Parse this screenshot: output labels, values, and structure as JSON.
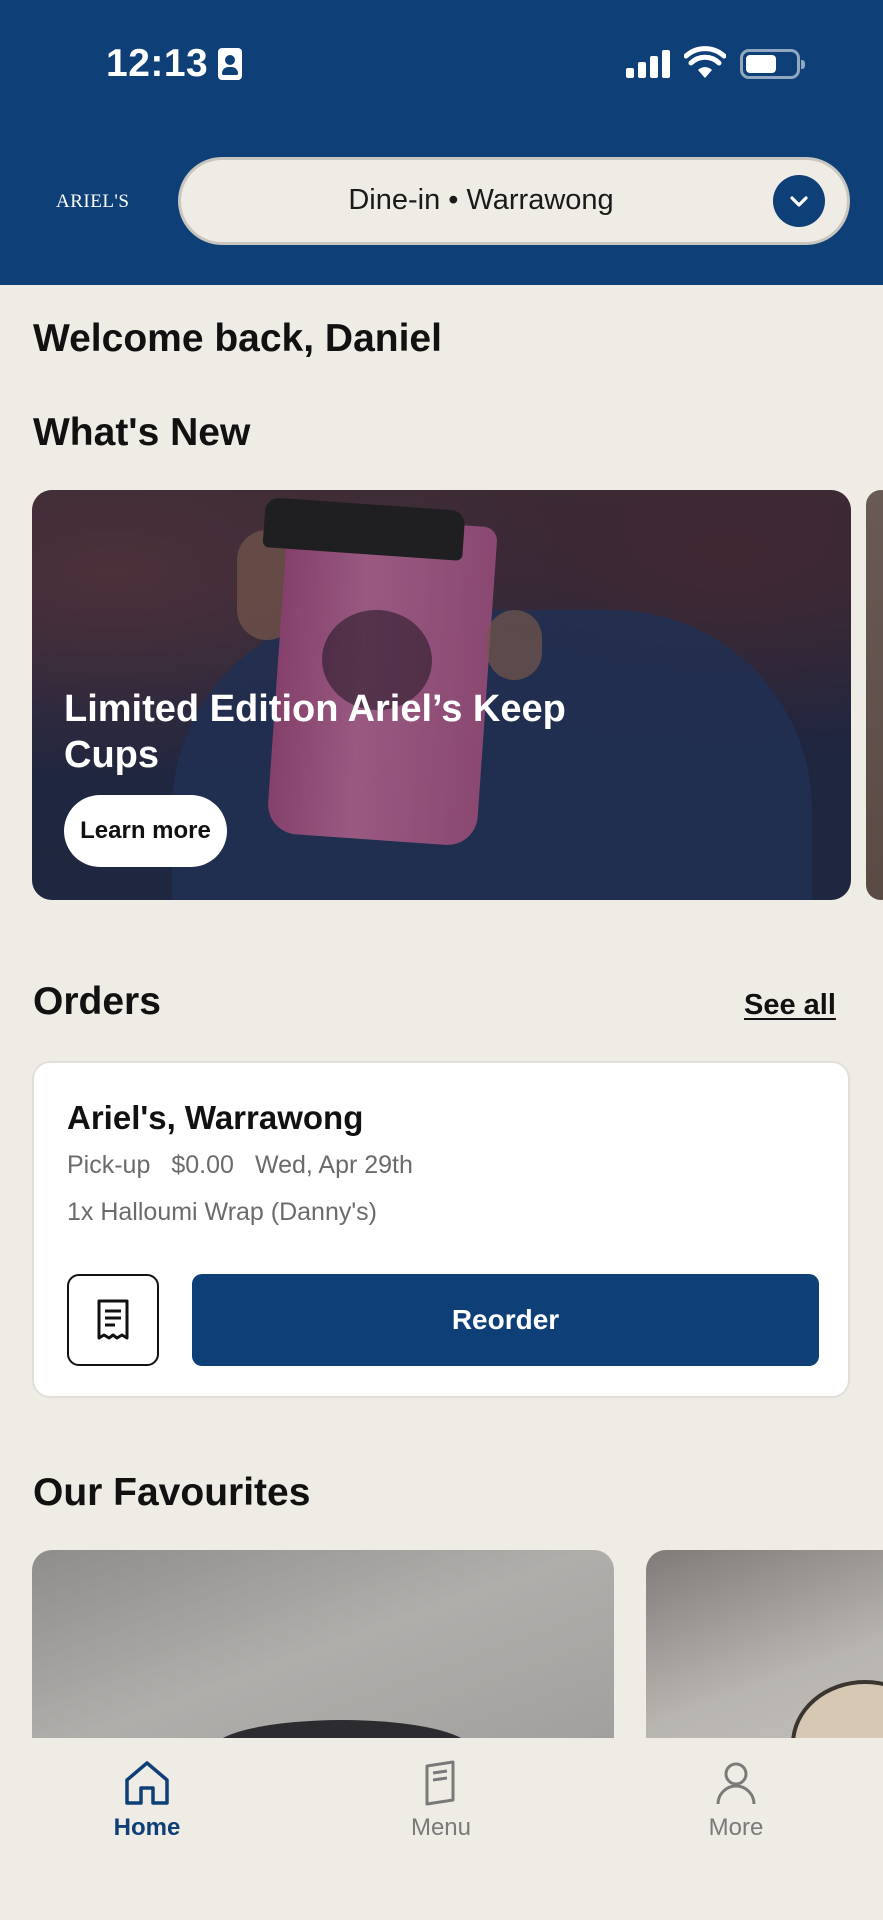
{
  "status_bar": {
    "time": "12:13"
  },
  "header": {
    "logo": "ARIEL'S",
    "location": "Dine-in • Warrawong"
  },
  "welcome": "Welcome back, Daniel",
  "whats_new": {
    "title": "What's New",
    "promo": {
      "title": "Limited Edition Ariel’s Keep Cups",
      "button": "Learn more"
    }
  },
  "orders": {
    "title": "Orders",
    "see_all": "See all",
    "card": {
      "store": "Ariel's, Warrawong",
      "type": "Pick-up",
      "price": "$0.00",
      "date": "Wed, Apr 29th",
      "items": "1x Halloumi Wrap (Danny's)",
      "reorder": "Reorder"
    }
  },
  "favourites": {
    "title": "Our Favourites"
  },
  "tabs": [
    {
      "label": "Home",
      "icon": "home-icon",
      "active": true
    },
    {
      "label": "Menu",
      "icon": "menu-book-icon",
      "active": false
    },
    {
      "label": "More",
      "icon": "person-icon",
      "active": false
    }
  ],
  "colors": {
    "brand_navy": "#0e3f77",
    "background": "#efece6",
    "inactive_tab": "#7a7a7a"
  }
}
